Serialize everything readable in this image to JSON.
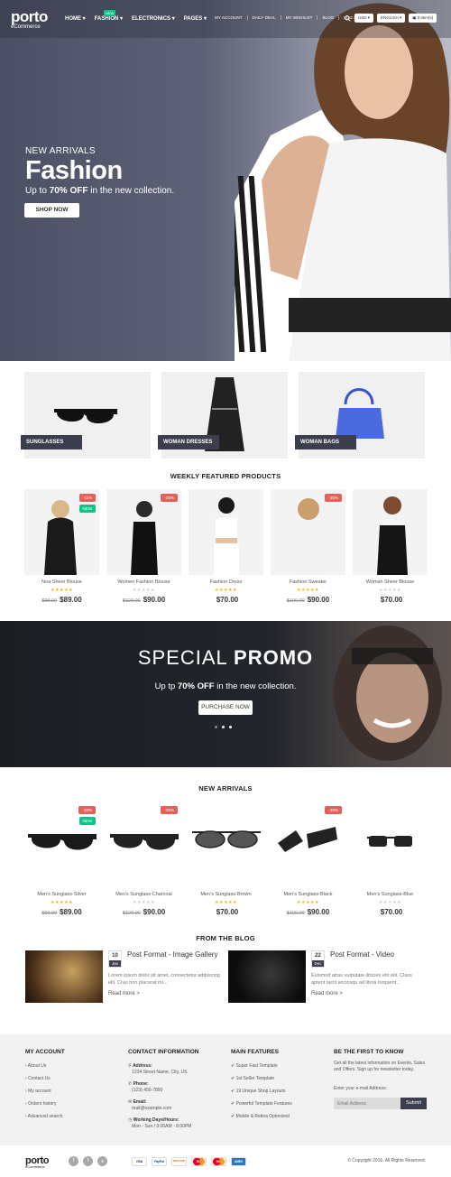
{
  "header": {
    "logo": "porto",
    "logo_sub": "eCommerce",
    "nav": [
      {
        "label": "HOME ▾"
      },
      {
        "label": "FASHION ▾"
      },
      {
        "label": "ELECTRONICS ▾"
      },
      {
        "label": "PAGES ▾"
      }
    ],
    "nav_badge": "NEW",
    "toplinks": [
      "MY ACCOUNT",
      "DAILY DEAL",
      "MY WISHLIST",
      "BLOG",
      "LOG IN"
    ],
    "currency": "USD ▾",
    "language": "ENGLISH ▾",
    "cart": "0 item(s)"
  },
  "hero": {
    "kicker": "NEW ARRIVALS",
    "title": "Fashion",
    "sub_pre": "Up to ",
    "sub_bold": "70% OFF",
    "sub_post": " in the new collection.",
    "button": "SHOP NOW"
  },
  "categories": [
    {
      "label": "SUNGLASSES"
    },
    {
      "label": "WOMAN DRESSES"
    },
    {
      "label": "WOMAN BAGS"
    }
  ],
  "featured": {
    "title": "WEEKLY FEATURED PRODUCTS",
    "items": [
      {
        "name": "Noa Sheer Blouse",
        "old": "$99.00",
        "price": "$89.00",
        "badge": "-11%",
        "new": "NEW",
        "stars": "★★★★★"
      },
      {
        "name": "Women Fashion Blouse",
        "old": "$120.00",
        "price": "$90.00",
        "badge": "-25%",
        "new": "",
        "stars": "★★★★★"
      },
      {
        "name": "Fashion Dress",
        "old": "",
        "price": "$70.00",
        "badge": "",
        "new": "",
        "stars": "★★★★★"
      },
      {
        "name": "Fashion Sweater",
        "old": "$100.00",
        "price": "$90.00",
        "badge": "-20%",
        "new": "",
        "stars": "★★★★★"
      },
      {
        "name": "Woman Sheer Blouse",
        "old": "",
        "price": "$70.00",
        "badge": "",
        "new": "",
        "stars": "★★★★★"
      }
    ]
  },
  "promo": {
    "title_light": "SPECIAL ",
    "title_bold": "PROMO",
    "sub_pre": "Up tp ",
    "sub_bold": "70% OFF",
    "sub_post": " in the new collection.",
    "button": "PURCHASE NOW"
  },
  "arrivals": {
    "title": "NEW ARRIVALS",
    "items": [
      {
        "name": "Men's Sunglass-Silver",
        "old": "$99.00",
        "price": "$89.00",
        "badge": "-10%",
        "new": "NEW",
        "stars": "★★★★★"
      },
      {
        "name": "Men's Sunglass-Charcoal",
        "old": "$120.00",
        "price": "$90.00",
        "badge": "-25%",
        "new": "",
        "stars": "★★★★★"
      },
      {
        "name": "Men's Sunglass-Brown",
        "old": "",
        "price": "$70.00",
        "badge": "",
        "new": "",
        "stars": "★★★★★"
      },
      {
        "name": "Men's Sunglass-Black",
        "old": "$100.00",
        "price": "$90.00",
        "badge": "-20%",
        "new": "",
        "stars": "★★★★★"
      },
      {
        "name": "Men's Sunglass-Blue",
        "old": "",
        "price": "$70.00",
        "badge": "",
        "new": "",
        "stars": "★★★★★"
      }
    ]
  },
  "blog": {
    "title": "FROM THE BLOG",
    "posts": [
      {
        "day": "10",
        "month": "Jan",
        "title": "Post Format - Image Gallery",
        "excerpt": "Lorem ipsum dolor sit amet, consectetur adipiscing elit. Cras non placerat mi...",
        "more": "Read more >"
      },
      {
        "day": "22",
        "month": "Dec",
        "title": "Post Format - Video",
        "excerpt": "Euismod atras vulputate iltricies etri elit. Class aptent taciti sociosqu ad litora torquent...",
        "more": "Read more >"
      }
    ]
  },
  "footer": {
    "account": {
      "title": "MY ACCOUNT",
      "links": [
        "About Us",
        "Contact Us",
        "My account",
        "Orders history",
        "Advanced search"
      ]
    },
    "contact": {
      "title": "CONTACT INFORMATION",
      "address_label": "Address:",
      "address": "1234 Street Name, City, US",
      "phone_label": "Phone:",
      "phone": "(123) 456-7890",
      "email_label": "Email:",
      "email": "mail@example.com",
      "hours_label": "Working Days/Hours:",
      "hours": "Mon - Sun / 9:00AM - 8:00PM"
    },
    "features": {
      "title": "MAIN FEATURES",
      "links": [
        "Super Fast Template",
        "1st Seller Template",
        "19 Unique Shop Layouts",
        "Powerful Template Features",
        "Mobile & Retina Optimized"
      ]
    },
    "newsletter": {
      "title": "BE THE FIRST TO KNOW",
      "text": "Get all the latest information on Events, Sales and Offers. Sign up for newsletter today.",
      "label": "Enter your e-mail Address:",
      "placeholder": "Email Address",
      "button": "Submit"
    },
    "social": [
      "f",
      "t",
      "in"
    ],
    "payments": [
      "VISA",
      "PayPal",
      "DISCOVER",
      "MC",
      "MC",
      "AMEX"
    ],
    "copyright": "© Copyright 2016. All Rights Reserved."
  },
  "colors": {
    "dark": "#3a3e4d",
    "sale": "#e36159",
    "new": "#0cc485",
    "star": "#f0b400"
  }
}
